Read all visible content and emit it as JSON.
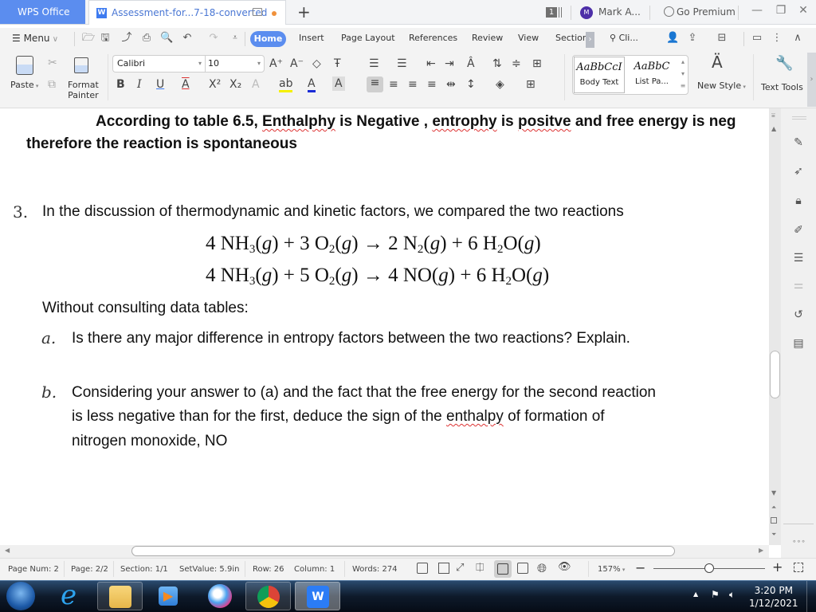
{
  "titlebar": {
    "app_tab": "WPS Office",
    "doc_tab": "Assessment-for...7-18-converted",
    "new_tab": "+",
    "window_count": "1",
    "avatar_initial": "M",
    "user_name": "Mark A...",
    "premium": "Go Premium",
    "minimize": "—",
    "restore": "❐",
    "close": "✕"
  },
  "menubar": {
    "menu_label": "Menu",
    "tabs": [
      "Home",
      "Insert",
      "Page Layout",
      "References",
      "Review",
      "View",
      "Sectior"
    ],
    "search_label": "Cli..."
  },
  "ribbon": {
    "paste": "Paste",
    "format_painter_line1": "Format",
    "format_painter_line2": "Painter",
    "font_name": "Calibri",
    "font_size": "10",
    "styles": [
      {
        "sample": "AaBbCcI",
        "name": "Body Text"
      },
      {
        "sample": "AaBbC",
        "name": "List Pa..."
      }
    ],
    "new_style": "New Style",
    "text_tools": "Text Tools"
  },
  "document": {
    "answer_line1": "According to table 6.5, Enthalphy is Negative , entrophy is positve and free energy is neg",
    "answer_line1_parts": {
      "pre": "According to table 6.5, ",
      "w1": "Enthalphy",
      "mid1": " is Negative , ",
      "w2": "entrophy",
      "mid2": " is ",
      "w3": "positve",
      "post": " and free energy is neg"
    },
    "answer_line2": "therefore the reaction is spontaneous",
    "question_number": "3.",
    "question_text": "In the discussion of thermodynamic and kinetic factors, we compared the two reactions",
    "equations": [
      "4 NH3(g) + 3 O2(g) → 2 N2(g) + 6 H2O(g)",
      "4 NH3(g) + 5 O2(g) → 4 NO(g) + 6 H2O(g)"
    ],
    "instruction": "Without consulting data tables:",
    "part_a_letter": "a.",
    "part_a": "Is there any major difference in entropy factors between the two reactions? Explain.",
    "part_b_letter": "b.",
    "part_b_line1": "Considering your answer to (a) and the fact that the free energy for the second reaction",
    "part_b_line2_pre": "is less negative than for the first, deduce the sign of the ",
    "part_b_line2_word": "enthalpy",
    "part_b_line2_post": " of formation of",
    "part_b_line3": "nitrogen monoxide, NO"
  },
  "sidepanel": {
    "icons": [
      "pen-icon",
      "cursor-icon",
      "lock-icon",
      "code-edit-icon",
      "brace-list-icon",
      "sliders-icon",
      "history-icon",
      "storage-icon"
    ]
  },
  "statusbar": {
    "page_num": "Page Num: 2",
    "page": "Page: 2/2",
    "section": "Section: 1/1",
    "set_value": "SetValue: 5.9in",
    "row": "Row: 26",
    "column": "Column: 1",
    "words": "Words: 274",
    "zoom": "157%",
    "zoom_fraction": 0.5
  },
  "taskbar": {
    "time": "3:20 PM",
    "date": "1/12/2021"
  },
  "colors": {
    "accent": "#5b8def",
    "doc_tab_text": "#4a77d4",
    "modified_dot": "#f0913b",
    "avatar": "#4d2fa8",
    "spell_error": "#dd3333"
  }
}
